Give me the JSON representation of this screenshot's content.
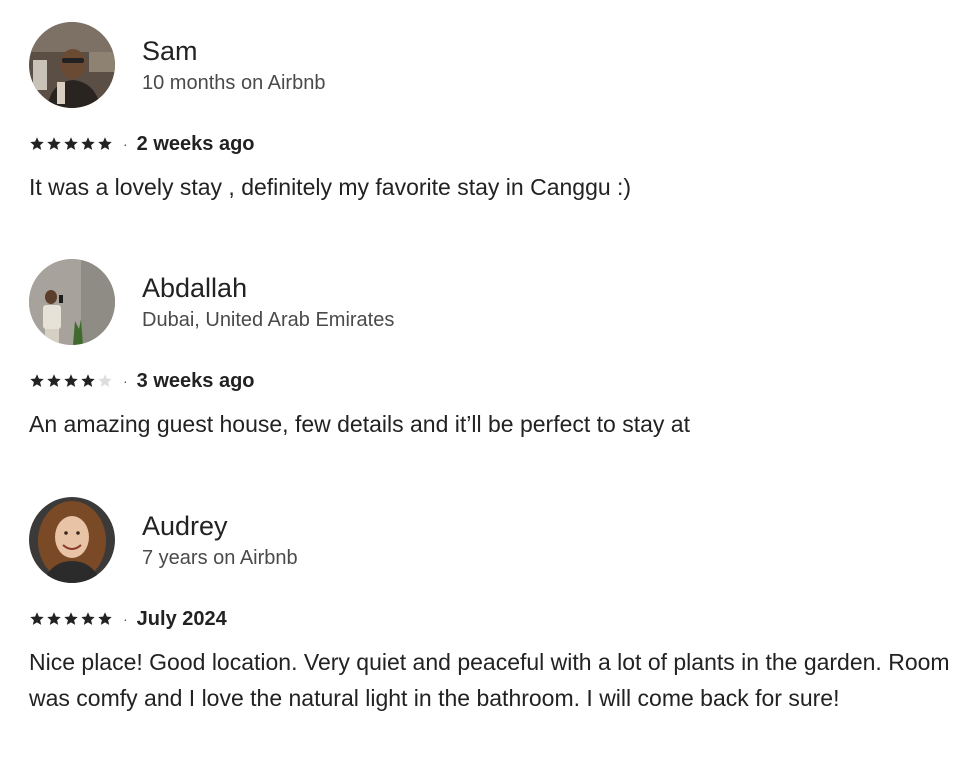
{
  "reviews": [
    {
      "name": "Sam",
      "meta": "10 months on Airbnb",
      "rating": 5,
      "date": "2 weeks ago",
      "text": "It was a lovely stay , definitely my favorite stay in Canggu :)"
    },
    {
      "name": "Abdallah",
      "meta": "Dubai, United Arab Emirates",
      "rating": 4,
      "date": "3 weeks ago",
      "text": "An amazing guest house, few details and it’ll be perfect to stay at"
    },
    {
      "name": "Audrey",
      "meta": "7 years on Airbnb",
      "rating": 5,
      "date": "July 2024",
      "text": "Nice place! Good location. Very quiet and peaceful with a lot of plants in the garden. Room was comfy and I love the natural light in the bathroom. I will come back for sure!"
    }
  ],
  "separator": "·",
  "colors": {
    "star_filled": "#222222",
    "star_empty": "#dddddd"
  }
}
